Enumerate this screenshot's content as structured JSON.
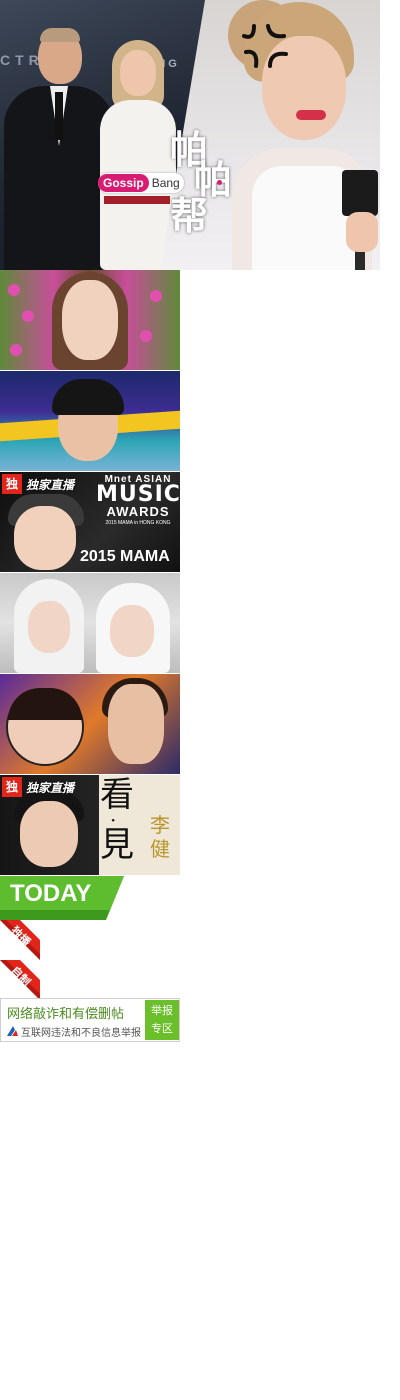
{
  "hero": {
    "brand_badge_pink": "Gossip",
    "brand_badge_text": "Bang",
    "logo_chars": [
      "帕",
      "帕",
      "帮"
    ],
    "bg_letters": "CTR",
    "bg_letters_2": "BEING"
  },
  "thumbnails": [
    {
      "id": "t1"
    },
    {
      "id": "t2"
    },
    {
      "id": "t3",
      "badge_box": "独",
      "badge_text": "独家直播",
      "mnet_top": "Mnet ASIAN",
      "mnet_mid": "MUSIC",
      "mnet_awards": "AWARDS",
      "mnet_small": "2015 MAMA in HONG KONG",
      "mnet_bottom": "2015 MAMA"
    },
    {
      "id": "t4"
    },
    {
      "id": "t5"
    },
    {
      "id": "t6",
      "badge_box": "独",
      "badge_text": "独家直播",
      "title_chars": [
        "看",
        "·",
        "見"
      ],
      "name_chars": [
        "李",
        "健"
      ]
    }
  ],
  "today": {
    "label": "TODAY"
  },
  "ribbons": [
    {
      "label": "独播"
    },
    {
      "label": "自制"
    }
  ],
  "report": {
    "line1": "网络敲诈和有偿删帖",
    "line2": "互联网违法和不良信息举报",
    "button_line1": "举报",
    "button_line2": "专区"
  },
  "colors": {
    "today_green": "#5dbd2e",
    "ribbon_red": "#e1251b",
    "report_green": "#6bbf2a",
    "gossip_pink": "#d81b73"
  }
}
